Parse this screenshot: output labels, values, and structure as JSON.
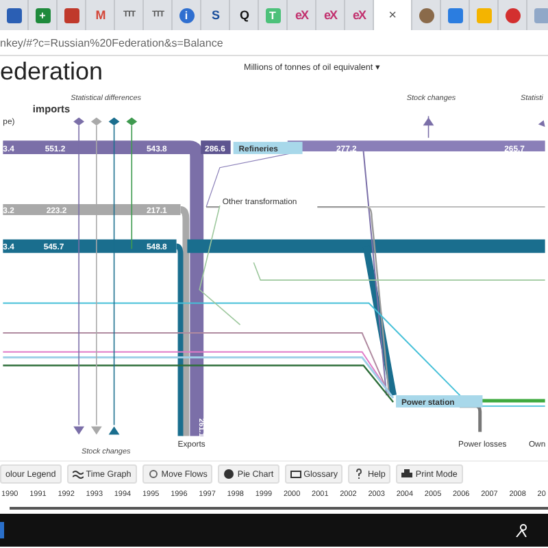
{
  "browser_tabs": [
    {
      "kind": "tile",
      "color": "#2b5fb4",
      "selected": false
    },
    {
      "kind": "tile",
      "color": "#1e8a3c",
      "glyph": "+",
      "selected": false
    },
    {
      "kind": "tile",
      "color": "#c0392b",
      "selected": false
    },
    {
      "kind": "letter",
      "color": "#d44638",
      "glyph": "M",
      "selected": false
    },
    {
      "kind": "letter",
      "color": "#555555",
      "glyph": "TTT",
      "selected": false
    },
    {
      "kind": "letter",
      "color": "#555555",
      "glyph": "TTT",
      "selected": false
    },
    {
      "kind": "circle",
      "color": "#2f6fd0",
      "glyph": "i",
      "selected": false
    },
    {
      "kind": "letter",
      "color": "#1a4f9c",
      "glyph": "S",
      "selected": false
    },
    {
      "kind": "letter",
      "color": "#111111",
      "glyph": "Q",
      "selected": false
    },
    {
      "kind": "tile",
      "color": "#4cc17a",
      "glyph": "T",
      "selected": false
    },
    {
      "kind": "letter",
      "color": "#c2306e",
      "glyph": "eX",
      "selected": false
    },
    {
      "kind": "letter",
      "color": "#c2306e",
      "glyph": "eX",
      "selected": false
    },
    {
      "kind": "letter",
      "color": "#c2306e",
      "glyph": "eX",
      "selected": false
    },
    {
      "kind": "close",
      "color": "#555555",
      "glyph": "×",
      "selected": true
    },
    {
      "kind": "circle",
      "color": "#8a6a4a",
      "selected": false
    },
    {
      "kind": "tile",
      "color": "#2b7de0",
      "selected": false
    },
    {
      "kind": "tile",
      "color": "#f4b400",
      "selected": false
    },
    {
      "kind": "circle",
      "color": "#d32f2f",
      "selected": false
    },
    {
      "kind": "tile",
      "color": "#90a8c8",
      "selected": false
    }
  ],
  "address_bar": {
    "url": "nkey/#?c=Russian%20Federation&s=Balance"
  },
  "page": {
    "title": "ederation",
    "unit_selector": "Millions of tonnes of oil equivalent",
    "unit_caret": "▾"
  },
  "sankey": {
    "source": {
      "title": "imports",
      "subtitle": "pe)"
    },
    "markers": [
      {
        "color": "#7b6fa8"
      },
      {
        "color": "#a9a9a9"
      },
      {
        "color": "#1a6e8e"
      },
      {
        "color": "#3f9a4f"
      }
    ],
    "annotations": [
      "Statistical differences",
      "Stock changes",
      "Statisti",
      "Stock changes"
    ],
    "nodes": [
      {
        "label": "Refineries",
        "kind": "box"
      },
      {
        "label": "Other transformation",
        "kind": "plain"
      },
      {
        "label": "Power station",
        "kind": "box"
      },
      {
        "label": "Exports",
        "kind": "plain"
      },
      {
        "label": "Power losses",
        "kind": "plain"
      },
      {
        "label": "Own",
        "kind": "plain"
      }
    ],
    "flow_values": [
      "3.4",
      "551.2",
      "543.8",
      "286.6",
      "277.2",
      "265.7",
      "3.2",
      "223.2",
      "217.1",
      "3.4",
      "545.7",
      "548.8",
      "261.1"
    ]
  },
  "toolbar": [
    "olour Legend",
    "Time Graph",
    "Move Flows",
    "Pie Chart",
    "Glossary",
    "Help",
    "Print Mode"
  ],
  "timeline": [
    "1990",
    "1991",
    "1992",
    "1993",
    "1994",
    "1995",
    "1996",
    "1997",
    "1998",
    "1999",
    "2000",
    "2001",
    "2002",
    "2003",
    "2004",
    "2005",
    "2006",
    "2007",
    "2008",
    "20"
  ]
}
